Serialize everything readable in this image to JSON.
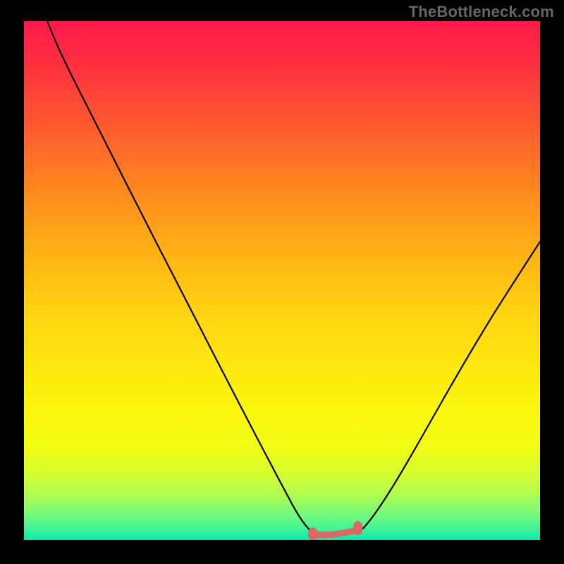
{
  "watermark": "TheBottleneck.com",
  "chart_data": {
    "type": "line",
    "title": "",
    "xlabel": "",
    "ylabel": "",
    "xlim": [
      0,
      1
    ],
    "ylim": [
      0,
      1
    ],
    "background_gradient": {
      "top": "#ff1a49",
      "upper": "#ffb315",
      "mid": "#fde90f",
      "lower": "#86fb6f",
      "bottom": "#0ce6af"
    },
    "series": [
      {
        "name": "left-curve",
        "type": "line",
        "comment": "Descending curve from top-left down to valley floor",
        "points": [
          {
            "x": 0.045,
            "y": 1.0
          },
          {
            "x": 0.07,
            "y": 0.94
          },
          {
            "x": 0.11,
            "y": 0.86
          },
          {
            "x": 0.15,
            "y": 0.782
          },
          {
            "x": 0.19,
            "y": 0.703
          },
          {
            "x": 0.23,
            "y": 0.625
          },
          {
            "x": 0.27,
            "y": 0.547
          },
          {
            "x": 0.31,
            "y": 0.47
          },
          {
            "x": 0.35,
            "y": 0.392
          },
          {
            "x": 0.39,
            "y": 0.315
          },
          {
            "x": 0.43,
            "y": 0.238
          },
          {
            "x": 0.47,
            "y": 0.162
          },
          {
            "x": 0.505,
            "y": 0.096
          },
          {
            "x": 0.53,
            "y": 0.05
          },
          {
            "x": 0.548,
            "y": 0.025
          },
          {
            "x": 0.56,
            "y": 0.013
          }
        ]
      },
      {
        "name": "right-curve",
        "type": "line",
        "comment": "Ascending curve from valley floor up to the right",
        "points": [
          {
            "x": 0.647,
            "y": 0.013
          },
          {
            "x": 0.66,
            "y": 0.025
          },
          {
            "x": 0.68,
            "y": 0.05
          },
          {
            "x": 0.71,
            "y": 0.095
          },
          {
            "x": 0.75,
            "y": 0.162
          },
          {
            "x": 0.79,
            "y": 0.232
          },
          {
            "x": 0.83,
            "y": 0.302
          },
          {
            "x": 0.87,
            "y": 0.37
          },
          {
            "x": 0.91,
            "y": 0.436
          },
          {
            "x": 0.95,
            "y": 0.498
          },
          {
            "x": 0.985,
            "y": 0.552
          },
          {
            "x": 1.0,
            "y": 0.575
          }
        ]
      },
      {
        "name": "valley-marker",
        "type": "marker-line",
        "color": "#d96a63",
        "comment": "Thick salmon horizontal segment with bulbous ends along the valley floor",
        "points": [
          {
            "x": 0.56,
            "y": 0.012
          },
          {
            "x": 0.647,
            "y": 0.019
          }
        ]
      }
    ]
  }
}
